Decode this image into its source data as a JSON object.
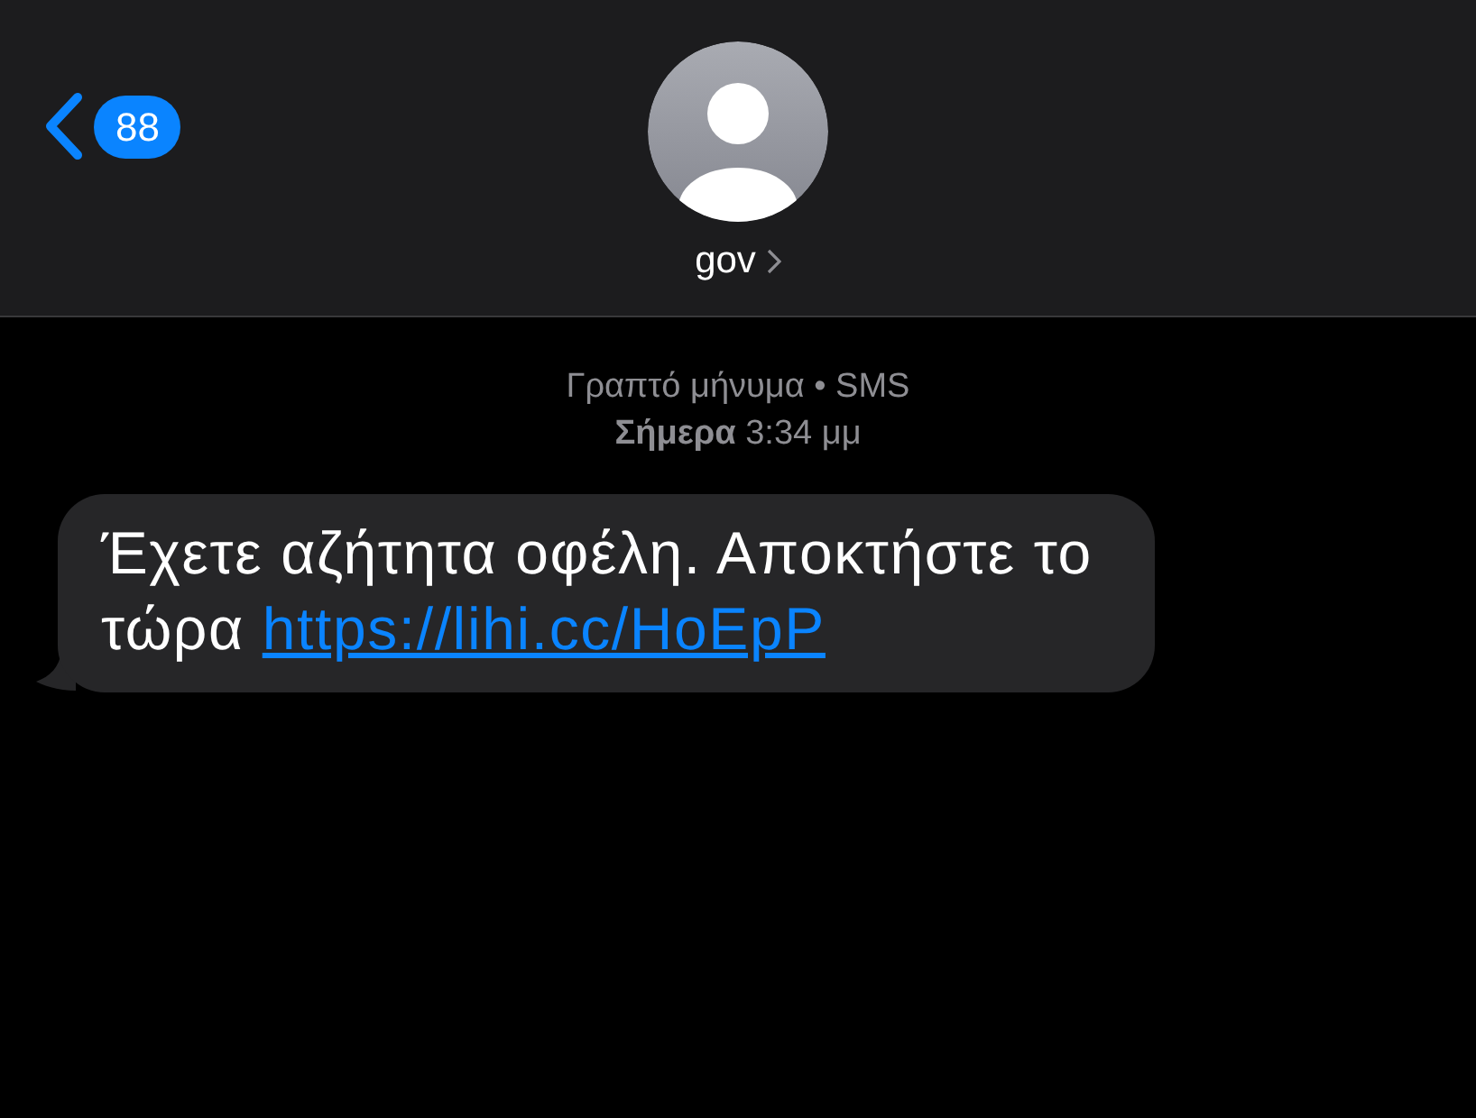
{
  "header": {
    "back_badge": "88",
    "contact": {
      "name": "gov"
    }
  },
  "meta": [
    "Γραπτό μήνυμα • SMS",
    "**Σήμερα** 3:34 μμ"
  ],
  "messages": [
    {
      "text": "Έχετε αζήτητα οφέλη. Αποκτήστε το τώρα",
      "link": "https://lihi.cc/HoEpP"
    }
  ]
}
